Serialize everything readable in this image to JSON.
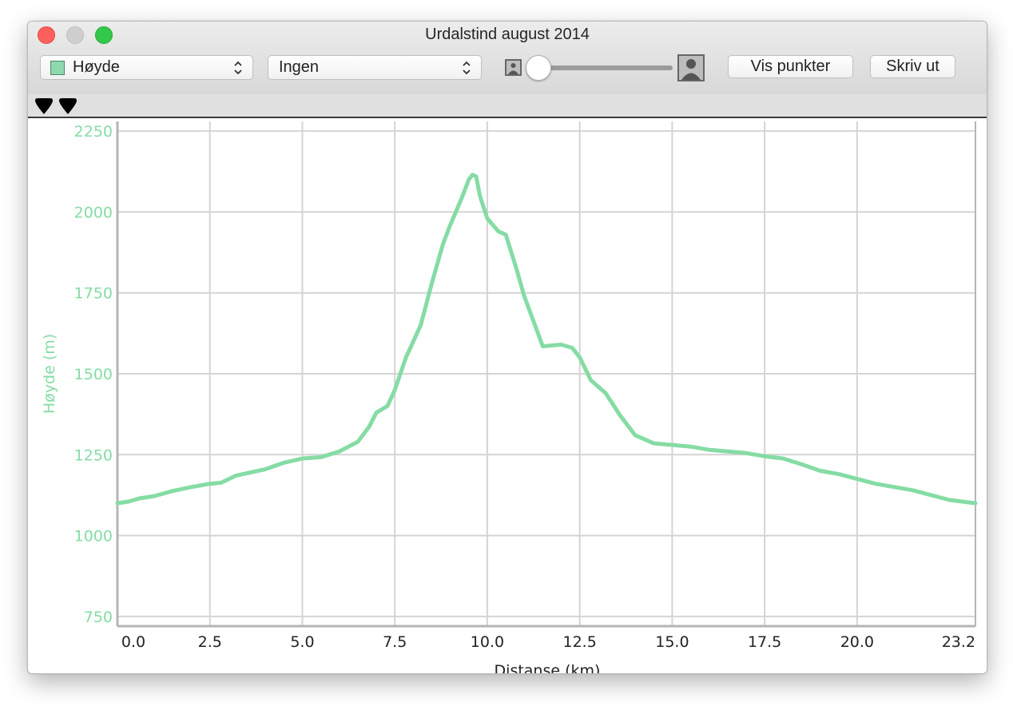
{
  "window": {
    "title": "Urdalstind august 2014"
  },
  "toolbar": {
    "series_select": {
      "value": "Høyde",
      "swatch_color": "#8fd8ae"
    },
    "second_select": {
      "value": "Ingen"
    },
    "photo_slider": {
      "value_fraction": 0.0,
      "min_icon": "person-photo-small-icon",
      "max_icon": "person-photo-large-icon"
    },
    "show_points_label": "Vis punkter",
    "print_label": "Skriv ut"
  },
  "markers": [
    {
      "icon": "marker-pin-icon"
    },
    {
      "icon": "marker-pin-icon"
    }
  ],
  "chart_data": {
    "type": "line",
    "ylabel": "Høyde (m)",
    "xlabel": "Distanse (km)",
    "xlim": [
      0.0,
      23.2
    ],
    "ylim": [
      720,
      2280
    ],
    "xticks": [
      "0.0",
      "2.5",
      "5.0",
      "7.5",
      "10.0",
      "12.5",
      "15.0",
      "17.5",
      "20.0",
      "23.2"
    ],
    "yticks": [
      "750",
      "1000",
      "1250",
      "1500",
      "1750",
      "2000",
      "2250"
    ],
    "grid": true,
    "line_color": "#85dca4",
    "axis_label_color": "#85dca4",
    "series": [
      {
        "x": [
          0.0,
          0.3,
          0.6,
          1.0,
          1.5,
          2.0,
          2.5,
          2.8,
          3.2,
          3.6,
          4.0,
          4.5,
          5.0,
          5.5,
          6.0,
          6.5,
          6.8,
          7.0,
          7.3,
          7.5,
          7.8,
          8.2,
          8.5,
          8.8,
          9.0,
          9.3,
          9.5,
          9.6,
          9.7,
          9.8,
          10.0,
          10.3,
          10.5,
          10.8,
          11.0,
          11.5,
          12.0,
          12.3,
          12.5,
          12.8,
          13.2,
          13.6,
          14.0,
          14.5,
          15.0,
          15.5,
          16.0,
          16.5,
          17.0,
          17.5,
          18.0,
          18.5,
          19.0,
          19.5,
          20.0,
          20.5,
          21.0,
          21.5,
          22.0,
          22.5,
          23.2
        ],
        "y": [
          1100,
          1105,
          1115,
          1122,
          1138,
          1150,
          1160,
          1163,
          1185,
          1195,
          1205,
          1225,
          1238,
          1242,
          1260,
          1290,
          1335,
          1380,
          1400,
          1450,
          1550,
          1650,
          1780,
          1900,
          1960,
          2040,
          2100,
          2115,
          2110,
          2050,
          1980,
          1940,
          1930,
          1820,
          1740,
          1585,
          1590,
          1580,
          1550,
          1480,
          1440,
          1370,
          1310,
          1285,
          1280,
          1275,
          1265,
          1260,
          1255,
          1245,
          1238,
          1220,
          1200,
          1190,
          1175,
          1160,
          1150,
          1140,
          1125,
          1110,
          1100
        ]
      }
    ]
  }
}
